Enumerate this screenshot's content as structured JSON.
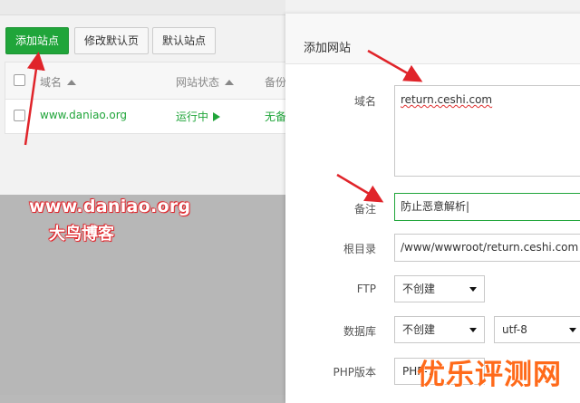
{
  "toolbar": {
    "add_site": "添加站点",
    "modify_default_page": "修改默认页",
    "default_site": "默认站点"
  },
  "table": {
    "columns": [
      "域名",
      "网站状态",
      "备份"
    ],
    "rows": [
      {
        "domain": "www.daniao.org",
        "status": "运行中",
        "backup": "无备"
      }
    ]
  },
  "dialog": {
    "title": "添加网站",
    "domain_label": "域名",
    "domain_value": "return.ceshi.com",
    "note_label": "备注",
    "note_value": "防止恶意解析",
    "root_label": "根目录",
    "root_value": "/www/wwwroot/return.ceshi.com",
    "ftp_label": "FTP",
    "ftp_value": "不创建",
    "db_label": "数据库",
    "db_value": "不创建",
    "db_charset": "utf-8",
    "php_label": "PHP版本",
    "php_value": "PHP-7"
  },
  "watermark": {
    "line1": "www.daniao.org",
    "line2": "大鸟博客",
    "logo": "优乐评测网"
  },
  "colors": {
    "accent_green": "#20a53a",
    "arrow_red": "#e0242a",
    "logo_orange": "#ff6a1a"
  }
}
